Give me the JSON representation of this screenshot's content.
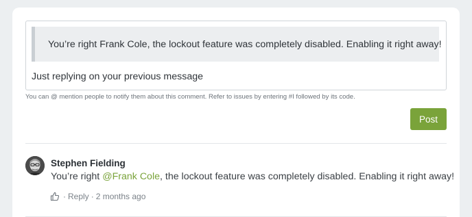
{
  "composer": {
    "quoted_text": "You’re right Frank Cole, the lockout feature was completely disabled. Enabling it right away!",
    "input_value": "Just replying on your previous message",
    "hint": "You can @ mention people to notify them about this comment. Refer to issues by entering #I followed by its code.",
    "post_label": "Post"
  },
  "comment": {
    "author": "Stephen Fielding",
    "body_prefix": "You’re right ",
    "mention": "@Frank Cole",
    "body_suffix": ", the lockout feature was completely disabled. Enabling it right away!",
    "reply_label": "Reply",
    "separator": "·",
    "timestamp": "2 months ago",
    "like_icon": "thumbs-up-icon"
  },
  "colors": {
    "accent": "#7aa33a",
    "background": "#eceff1"
  }
}
